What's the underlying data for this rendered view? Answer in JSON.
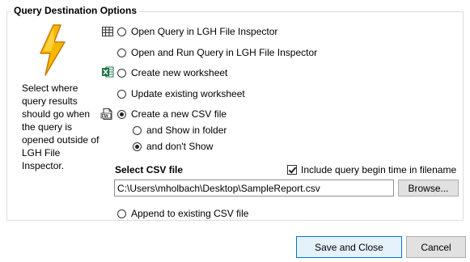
{
  "group": {
    "title": "Query Destination Options"
  },
  "help_text": "Select where query results should go when the query is opened outside of LGH File Inspector.",
  "options": {
    "open_query": {
      "label": "Open Query in LGH File Inspector",
      "checked": false
    },
    "open_run_query": {
      "label": "Open and Run Query in LGH File Inspector",
      "checked": false
    },
    "create_worksheet": {
      "label": "Create new worksheet",
      "checked": false
    },
    "update_worksheet": {
      "label": "Update existing worksheet",
      "checked": false
    },
    "create_csv": {
      "label": "Create a new CSV file",
      "checked": true
    },
    "show_in_folder": {
      "label": "and Show in folder",
      "checked": false
    },
    "dont_show": {
      "label": "and don't Show",
      "checked": true
    },
    "append_csv": {
      "label": "Append to existing CSV file",
      "checked": false
    }
  },
  "csv": {
    "section_label": "Select CSV file",
    "include_time_label": "Include query begin time in filename",
    "include_time_checked": true,
    "path_value": "C:\\Users\\mholbach\\Desktop\\SampleReport.csv",
    "browse_label": "Browse..."
  },
  "buttons": {
    "save_close": "Save and Close",
    "cancel": "Cancel"
  },
  "colors": {
    "bolt_fill": "#f5b800",
    "bolt_stroke": "#c77b00",
    "excel_green": "#1e7145",
    "primary_border": "#0078d7"
  },
  "icons": {
    "bolt": "lightning-bolt-icon",
    "table": "table-grid-icon",
    "excel": "excel-icon",
    "csv": "csv-file-icon"
  }
}
